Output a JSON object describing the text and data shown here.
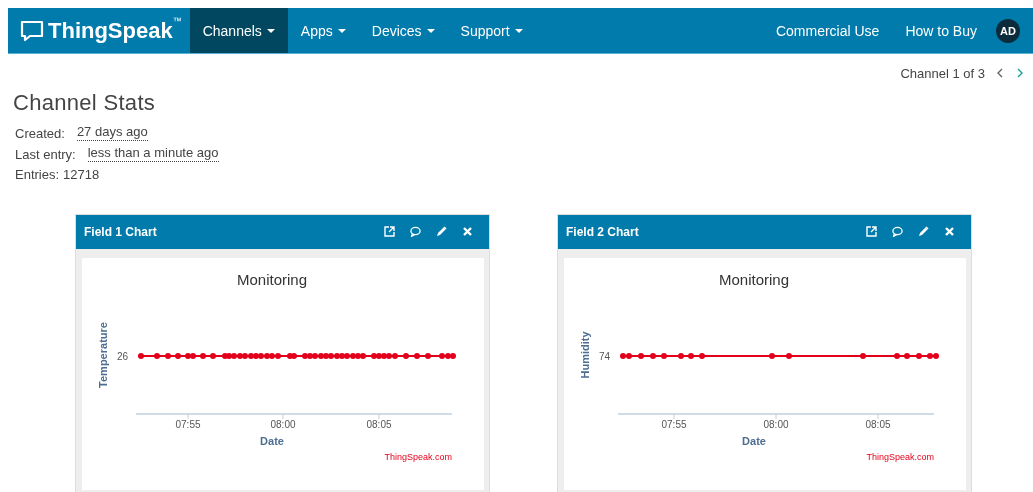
{
  "navbar": {
    "brand": "ThingSpeak$^{™}$",
    "menu": [
      {
        "label": "Channels",
        "selected": true
      },
      {
        "label": "Apps",
        "selected": false
      },
      {
        "label": "Devices",
        "selected": false
      },
      {
        "label": "Support",
        "selected": false
      }
    ],
    "right_links": [
      "Commercial Use",
      "How to Buy"
    ],
    "avatar": "AD"
  },
  "pager": {
    "label": "Channel 1 of 3",
    "buttons": [
      {
        "kind": "prev",
        "disabled": true
      },
      {
        "kind": "next",
        "disabled": false
      }
    ]
  },
  "title": "Channel Stats",
  "stats": [
    {
      "label": "Created:",
      "value": "27 days ago",
      "kind": "time"
    },
    {
      "label": "Last entry:",
      "value": "less than a minute ago",
      "kind": "time"
    },
    {
      "label": "Entries:",
      "value": "12718",
      "kind": "plain"
    }
  ],
  "cards": [
    {
      "title": "Field 1 Chart",
      "chart": {
        "title": "Monitoring",
        "ylabel": "Temperature",
        "y_label": "26",
        "xticks": [
          "07:55",
          "08:00",
          "08:05"
        ],
        "xlabel": "Date",
        "credit": "ThingSpeak.com"
      }
    },
    {
      "title": "Field 2 Chart",
      "chart": {
        "title": "Monitoring",
        "ylabel": "Humidity",
        "y_label": "74",
        "xticks": [
          "07:55",
          "08:00",
          "08:05"
        ],
        "xlabel": "Date",
        "credit": "ThingSpeak.com"
      }
    }
  ]
}
